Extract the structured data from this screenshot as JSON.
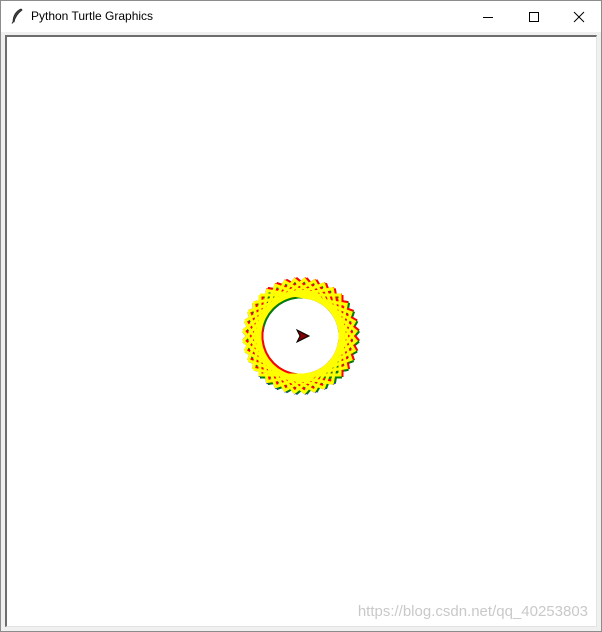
{
  "window": {
    "title": "Python Turtle Graphics",
    "icon": "feather-icon",
    "controls": {
      "minimize": "minimize-icon",
      "maximize": "maximize-icon",
      "close": "close-icon"
    }
  },
  "drawing": {
    "pen_colors": [
      "#0000ff",
      "#008000",
      "#ff0000",
      "#ffff00"
    ],
    "turtle_color": "#800000",
    "turtle_icon": "turtle-arrow-icon"
  },
  "watermark": {
    "text": "https://blog.csdn.net/qq_40253803"
  }
}
